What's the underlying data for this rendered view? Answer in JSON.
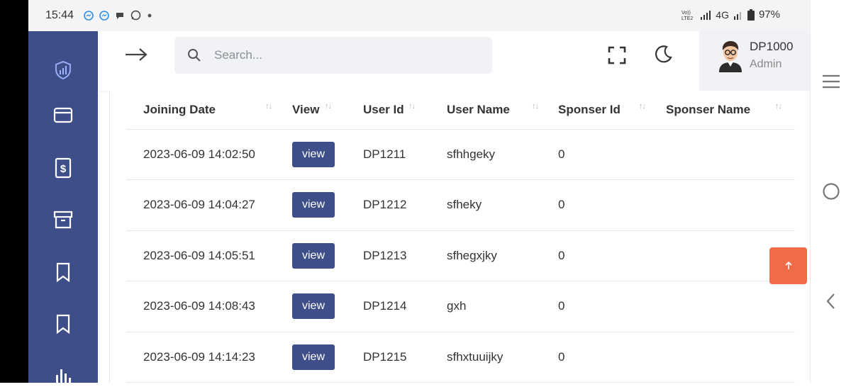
{
  "status_bar": {
    "time": "15:44",
    "network": "4G",
    "battery": "97%"
  },
  "sidebar": {
    "items": [
      {
        "icon": "shield-chart-icon"
      },
      {
        "icon": "wallet-icon"
      },
      {
        "icon": "dollar-receipt-icon"
      },
      {
        "icon": "archive-icon"
      },
      {
        "icon": "bookmark-icon"
      },
      {
        "icon": "bookmark-icon"
      },
      {
        "icon": "bar-chart-icon"
      }
    ]
  },
  "header": {
    "search_placeholder": "Search...",
    "user_name": "DP1000",
    "user_role": "Admin"
  },
  "table": {
    "columns": [
      "Joining Date",
      "View",
      "User Id",
      "User Name",
      "Sponser Id",
      "Sponser Name"
    ],
    "view_label": "view",
    "rows": [
      {
        "date": "2023-06-09 14:02:50",
        "user_id": "DP1211",
        "user_name": "sfhhgeky",
        "sponser_id": "0",
        "sponser_name": ""
      },
      {
        "date": "2023-06-09 14:04:27",
        "user_id": "DP1212",
        "user_name": "sfheky",
        "sponser_id": "0",
        "sponser_name": ""
      },
      {
        "date": "2023-06-09 14:05:51",
        "user_id": "DP1213",
        "user_name": "sfhegxjky",
        "sponser_id": "0",
        "sponser_name": ""
      },
      {
        "date": "2023-06-09 14:08:43",
        "user_id": "DP1214",
        "user_name": "gxh",
        "sponser_id": "0",
        "sponser_name": ""
      },
      {
        "date": "2023-06-09 14:14:23",
        "user_id": "DP1215",
        "user_name": "sfhxtuuijky",
        "sponser_id": "0",
        "sponser_name": ""
      }
    ]
  },
  "colors": {
    "sidebar": "#3e4e88",
    "accent": "#3e4e88",
    "scroll_top": "#f26b47"
  }
}
